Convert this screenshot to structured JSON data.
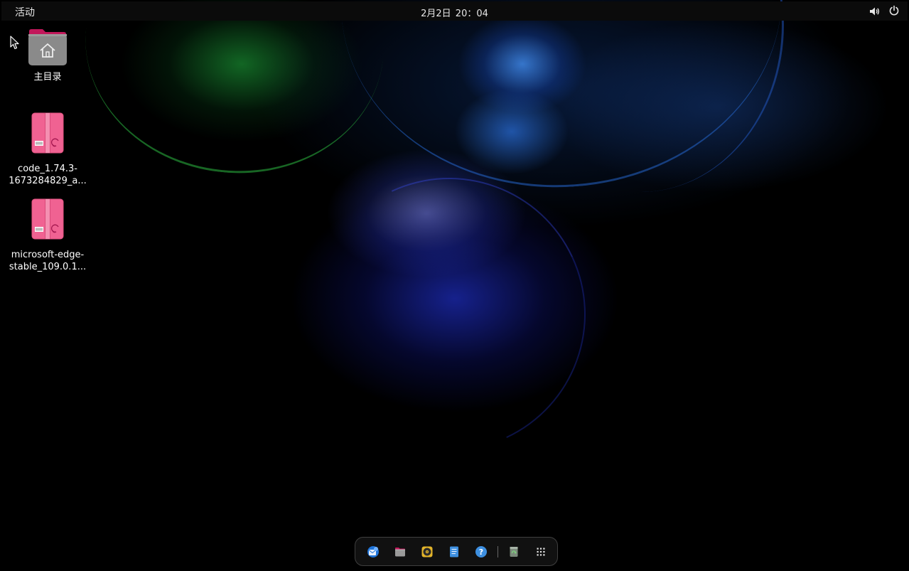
{
  "top_bar": {
    "activities_label": "活动",
    "clock": {
      "date": "2月2日",
      "time": "20：04"
    },
    "status_icons": [
      "volume-icon",
      "power-icon"
    ]
  },
  "desktop": {
    "icons": [
      {
        "label": "主目录",
        "icon": "home-folder-icon"
      },
      {
        "label_line1": "code_1.74.3-",
        "label_line2": "1673284829_a...",
        "icon": "deb-package-icon"
      },
      {
        "label_line1": "microsoft-edge-",
        "label_line2": "stable_109.0.1...",
        "icon": "deb-package-icon"
      }
    ]
  },
  "dock": {
    "items": [
      {
        "name": "thunderbird",
        "icon": "mail-client-icon"
      },
      {
        "name": "files",
        "icon": "file-manager-icon"
      },
      {
        "name": "rhythmbox",
        "icon": "music-player-icon"
      },
      {
        "name": "text-editor",
        "icon": "text-editor-icon"
      },
      {
        "name": "help",
        "icon": "help-icon"
      },
      {
        "name": "trash",
        "icon": "trash-icon"
      },
      {
        "name": "show-apps",
        "icon": "app-grid-icon"
      }
    ]
  },
  "colors": {
    "top_bar_bg": "#0b0b0b",
    "package_pink": "#f06292",
    "folder_gray": "#8a8a8a",
    "folder_tab": "#c2185b"
  }
}
